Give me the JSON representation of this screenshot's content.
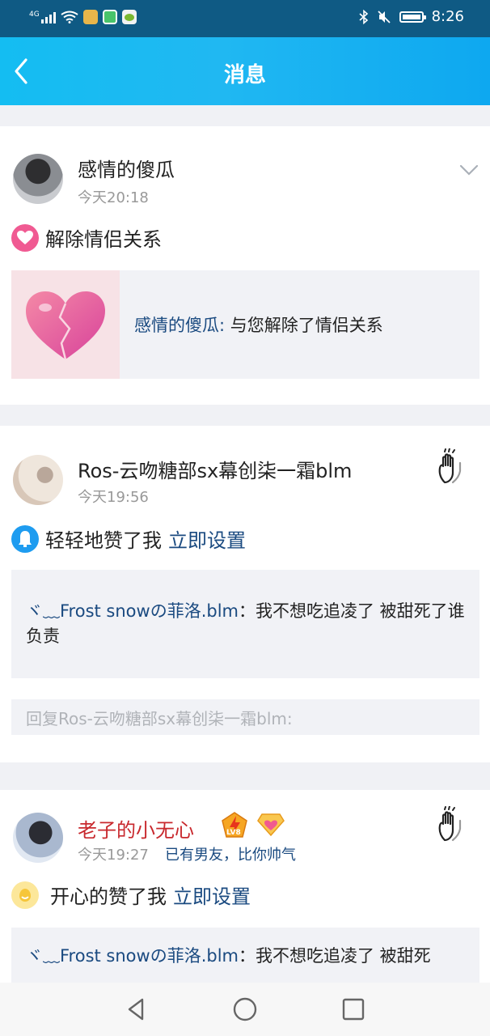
{
  "status_bar": {
    "network": "4G",
    "time": "8:26"
  },
  "header": {
    "title": "消息"
  },
  "messages": [
    {
      "name": "感情的傻瓜",
      "time": "今天20:18",
      "action": "解除情侣关系",
      "content_author": "感情的傻瓜:",
      "content_text": " 与您解除了情侣关系"
    },
    {
      "name": "Ros-云吻糖部sx幕创柒一霜blm",
      "time": "今天19:56",
      "action": "轻轻地赞了我",
      "action_link": "立即设置",
      "quote_author": "ヾ﹏Frost snowの菲洛.blm",
      "quote_text": "：我不想吃追凌了 被甜死了谁负责",
      "reply_placeholder": "回复Ros-云吻糖部sx幕创柒一霜blm:"
    },
    {
      "name": "老子的小无心",
      "time": "今天19:27",
      "signature": "已有男友，比你帅气",
      "action": "开心的赞了我",
      "action_link": "立即设置",
      "badge_level": "LV8",
      "quote_author": "ヾ﹏Frost snowの菲洛.blm",
      "quote_text": "：我不想吃追凌了 被甜死"
    }
  ],
  "colors": {
    "accent": "#16b4f0",
    "link": "#1a4a80",
    "vip_name": "#c8282d"
  }
}
